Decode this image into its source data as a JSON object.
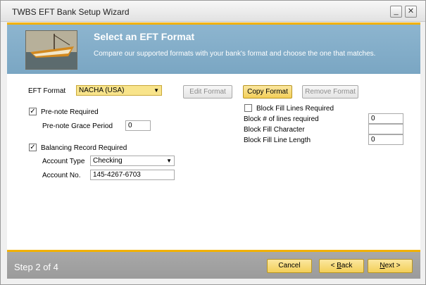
{
  "window": {
    "title": "TWBS EFT Bank Setup Wizard",
    "minimize_glyph": "_",
    "close_glyph": "✕"
  },
  "header": {
    "title": "Select an EFT Format",
    "subtitle": "Compare our supported formats with your bank's format and choose the one that matches."
  },
  "eft": {
    "label": "EFT Format",
    "selected": "NACHA (USA)",
    "edit_label": "Edit Format",
    "copy_label": "Copy Format",
    "remove_label": "Remove Format"
  },
  "prenote": {
    "label": "Pre-note Required",
    "checked": true,
    "grace_label": "Pre-note Grace Period",
    "grace_value": "0"
  },
  "balancing": {
    "label": "Balancing Record Required",
    "checked": true,
    "account_type_label": "Account Type",
    "account_type_value": "Checking",
    "account_no_label": "Account No.",
    "account_no_value": "145-4267-6703"
  },
  "block_fill": {
    "label": "Block Fill Lines Required",
    "checked": false,
    "lines_label": "Block # of lines required",
    "lines_value": "0",
    "char_label": "Block Fill Character",
    "char_value": "",
    "length_label": "Block Fill Line Length",
    "length_value": "0"
  },
  "footer": {
    "step": "Step 2 of 4",
    "cancel_label": "Cancel",
    "back_prefix": "< ",
    "back_key": "B",
    "back_rest": "ack",
    "next_key": "N",
    "next_rest": "ext >"
  },
  "colors": {
    "accent": "#f2b100",
    "header_blue": "#7aa6c3",
    "footer_gray": "#9b9b9b"
  }
}
